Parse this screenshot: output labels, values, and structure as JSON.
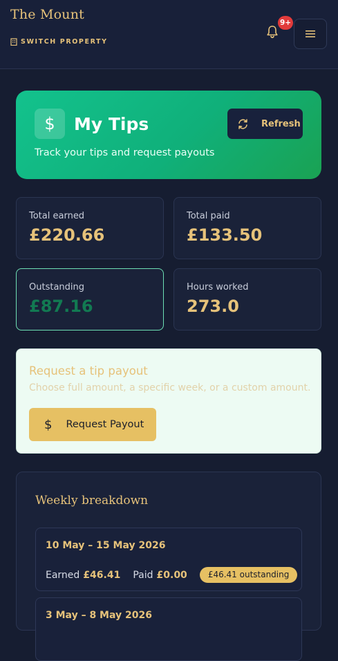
{
  "header": {
    "brand": "The Mount",
    "switch_label": "SWITCH PROPERTY",
    "notification_count": "9+"
  },
  "hero": {
    "title": "My Tips",
    "subtitle": "Track your tips and request payouts",
    "refresh_label": "Refresh",
    "icon": "$"
  },
  "stats": {
    "total_earned": {
      "label": "Total earned",
      "value": "£220.66"
    },
    "total_paid": {
      "label": "Total paid",
      "value": "£133.50"
    },
    "outstanding": {
      "label": "Outstanding",
      "value": "£87.16"
    },
    "hours_worked": {
      "label": "Hours worked",
      "value": "273.0"
    }
  },
  "payout": {
    "title": "Request a tip payout",
    "description": "Choose full amount, a specific week, or a custom amount.",
    "button_label": "Request Payout",
    "button_icon": "$"
  },
  "weekly": {
    "title": "Weekly breakdown",
    "weeks": [
      {
        "range": "10 May – 15 May 2026",
        "earned_label": "Earned",
        "earned": "£46.41",
        "paid_label": "Paid",
        "paid": "£0.00",
        "status": "£46.41 outstanding"
      },
      {
        "range": "3 May – 8 May 2026"
      }
    ]
  },
  "colors": {
    "accent_gold": "#e6c27a",
    "hero_green": "#13c28d",
    "background": "#161d31",
    "badge_red": "#e23b3b"
  }
}
